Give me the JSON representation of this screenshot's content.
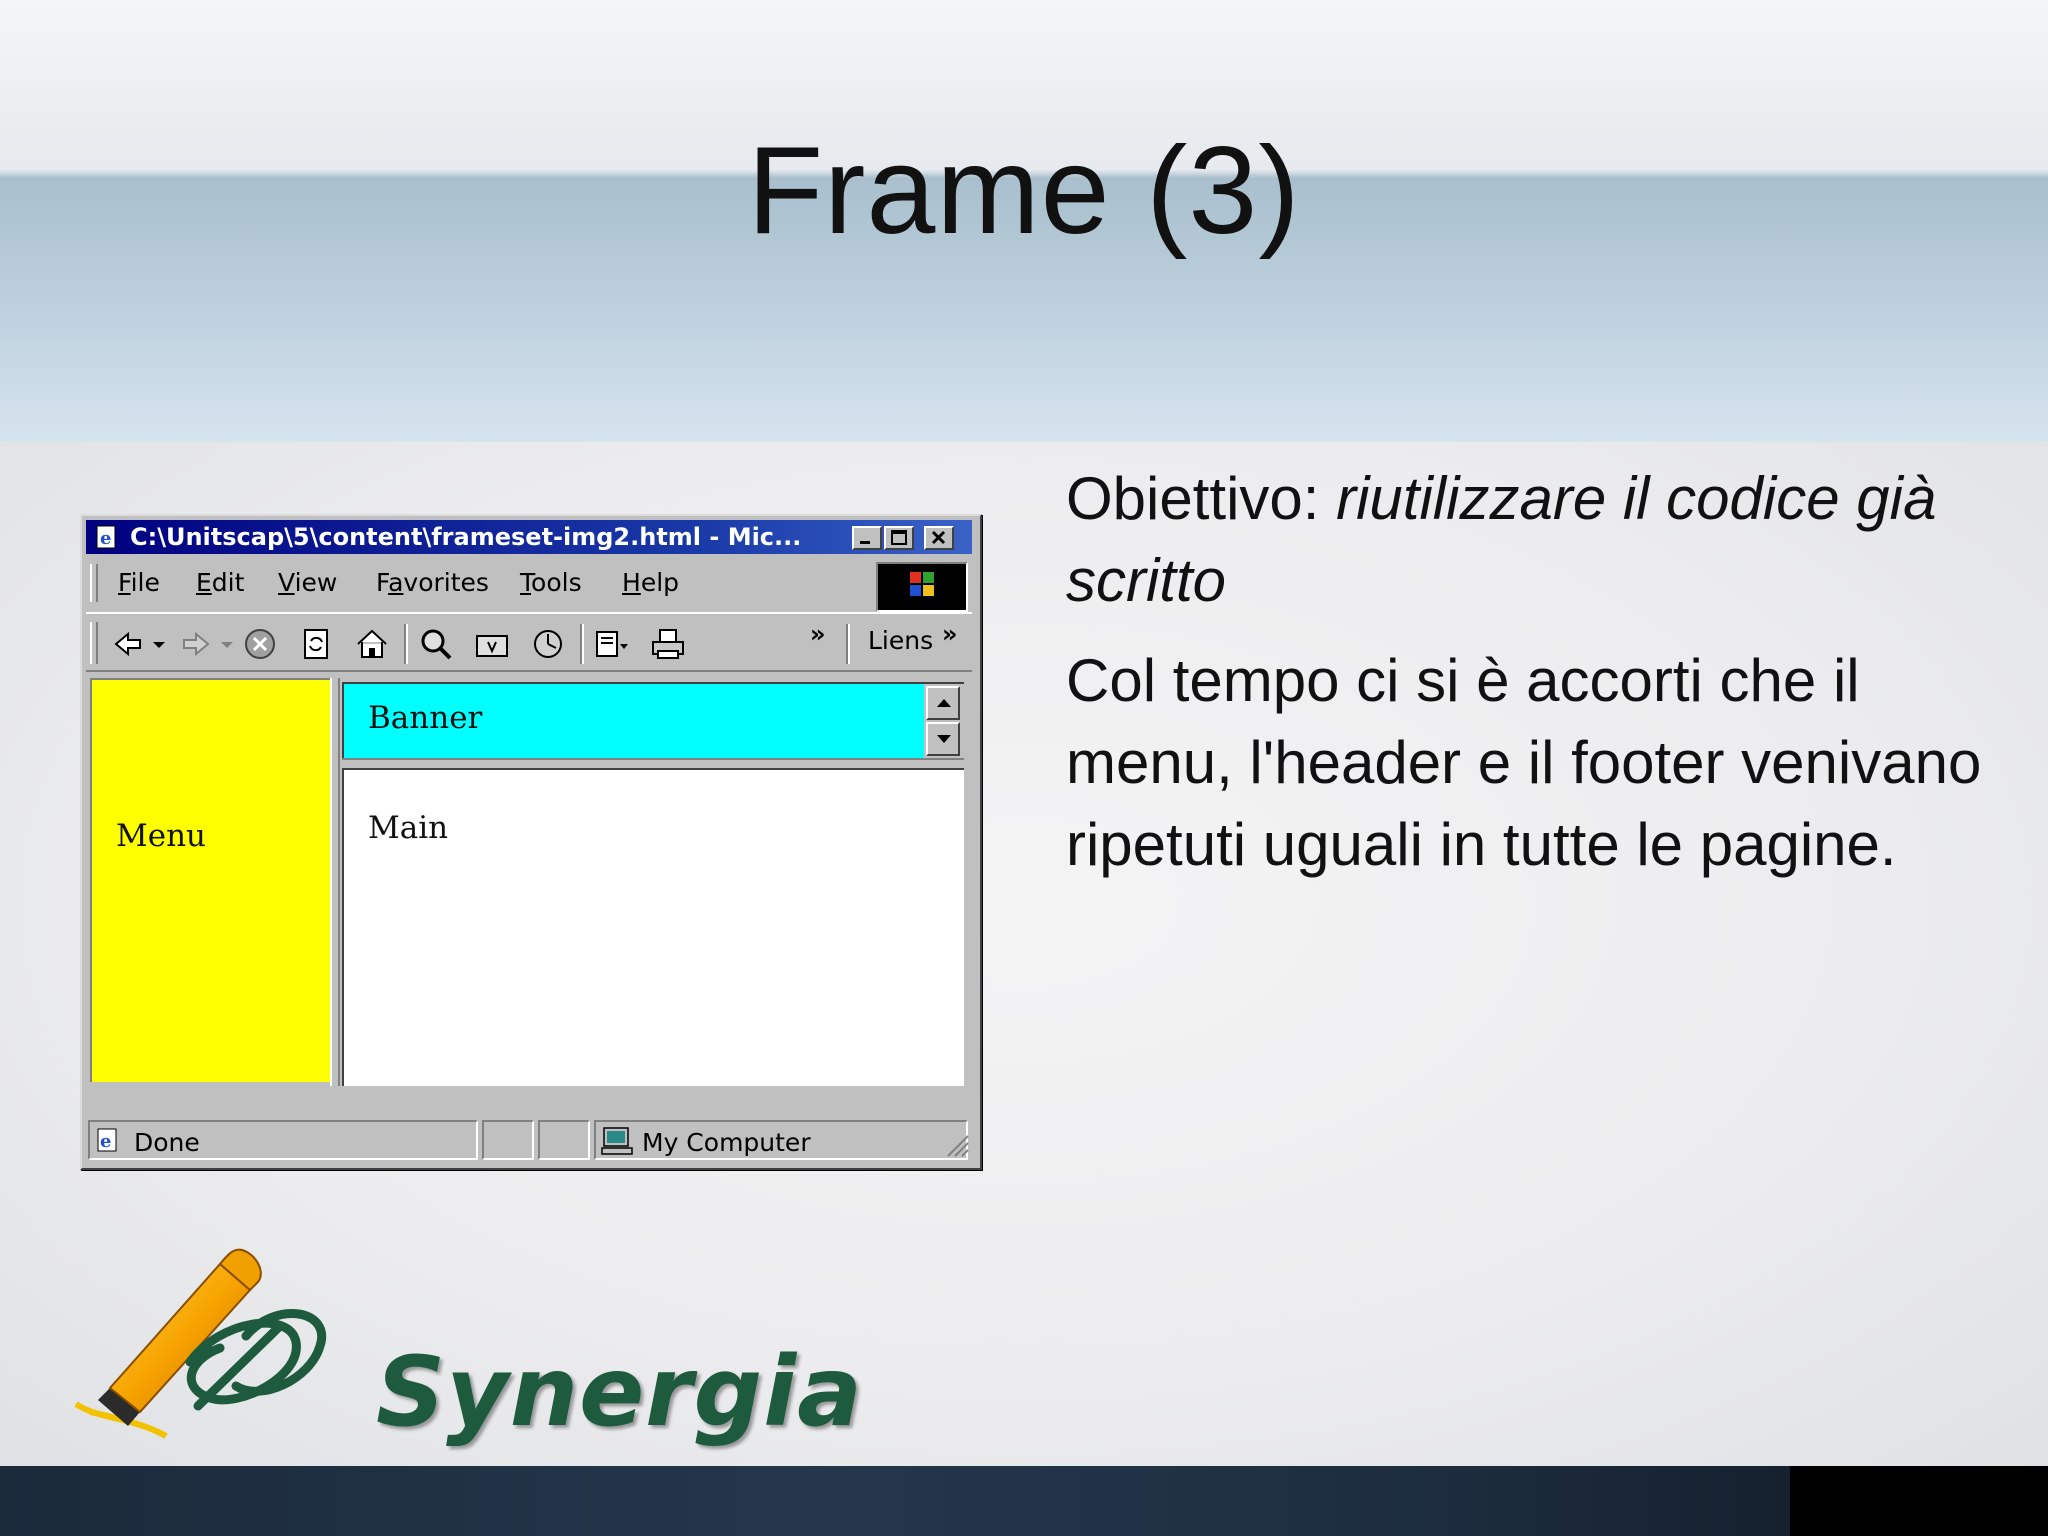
{
  "slide": {
    "title": "Frame (3)",
    "paragraph1_prefix": "Obiettivo: ",
    "paragraph1_emphasis": "riutilizzare il codice già scritto",
    "paragraph2": "Col tempo ci si è accorti che il menu, l'header e il footer venivano ripetuti uguali in tutte le pagine."
  },
  "browser": {
    "window_title": "C:\\Unitscap\\5\\content\\frameset-img2.html - Mic...",
    "menu": [
      {
        "key": "F",
        "rest": "ile"
      },
      {
        "key": "E",
        "rest": "dit"
      },
      {
        "key": "V",
        "rest": "iew"
      },
      {
        "pre": "F",
        "key": "a",
        "rest": "vorites"
      },
      {
        "key": "T",
        "rest": "ools"
      },
      {
        "key": "H",
        "rest": "elp"
      }
    ],
    "links_label": "Liens",
    "frames": {
      "menu_label": "Menu",
      "banner_label": "Banner",
      "main_label": "Main"
    },
    "status": {
      "text": "Done",
      "zone": "My Computer"
    },
    "colors": {
      "titlebar": "#000080",
      "menu_frame": "#ffff00",
      "banner_frame": "#00ffff",
      "main_frame": "#ffffff"
    }
  },
  "logo": {
    "text": "Synergia",
    "color": "#1d5a3e"
  }
}
